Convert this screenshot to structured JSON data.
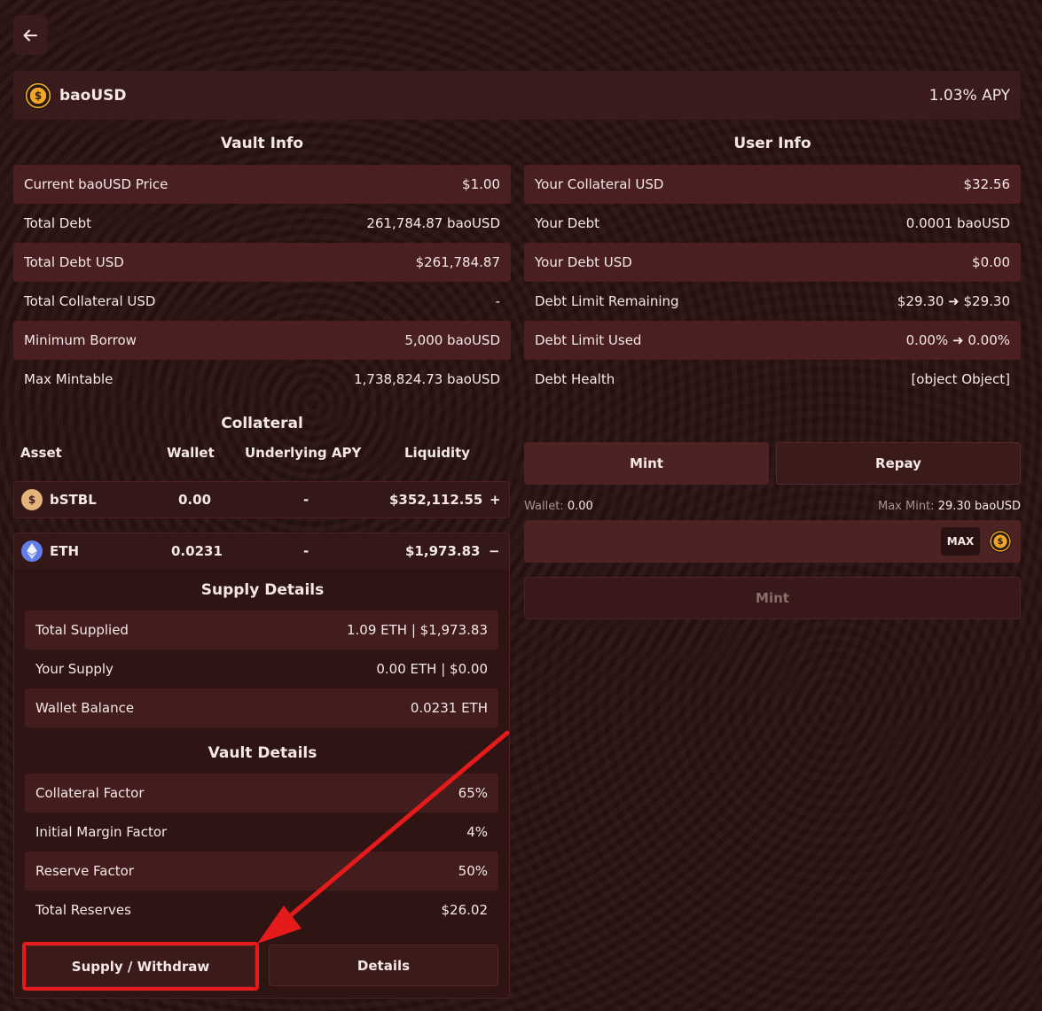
{
  "header": {
    "token_name": "baoUSD",
    "apy": "1.03% APY",
    "token_icon": "baousd-coin-icon"
  },
  "vault_info": {
    "title": "Vault Info",
    "rows": [
      {
        "label": "Current baoUSD Price",
        "value": "$1.00"
      },
      {
        "label": "Total Debt",
        "value": "261,784.87 baoUSD"
      },
      {
        "label": "Total Debt USD",
        "value": "$261,784.87"
      },
      {
        "label": "Total Collateral USD",
        "value": "-"
      },
      {
        "label": "Minimum Borrow",
        "value": "5,000 baoUSD"
      },
      {
        "label": "Max Mintable",
        "value": "1,738,824.73 baoUSD"
      }
    ]
  },
  "user_info": {
    "title": "User Info",
    "rows": [
      {
        "label": "Your Collateral USD",
        "value": "$32.56"
      },
      {
        "label": "Your Debt",
        "value": "0.0001 baoUSD"
      },
      {
        "label": "Your Debt USD",
        "value": "$0.00"
      },
      {
        "label": "Debt Limit Remaining",
        "value": "$29.30 ➜ $29.30"
      },
      {
        "label": "Debt Limit Used",
        "value": "0.00% ➜ 0.00%"
      },
      {
        "label": "Debt Health",
        "value": "[object Object]"
      }
    ]
  },
  "collateral": {
    "title": "Collateral",
    "columns": [
      "Asset",
      "Wallet",
      "Underlying APY",
      "Liquidity"
    ],
    "assets": [
      {
        "name": "bSTBL",
        "wallet": "0.00",
        "apy": "-",
        "liquidity": "$352,112.55",
        "toggle": "+"
      },
      {
        "name": "ETH",
        "wallet": "0.0231",
        "apy": "-",
        "liquidity": "$1,973.83",
        "toggle": "−"
      }
    ]
  },
  "supply_details": {
    "title": "Supply Details",
    "rows": [
      {
        "label": "Total Supplied",
        "value": "1.09 ETH | $1,973.83"
      },
      {
        "label": "Your Supply",
        "value": "0.00 ETH | $0.00"
      },
      {
        "label": "Wallet Balance",
        "value": "0.0231 ETH"
      }
    ]
  },
  "vault_details": {
    "title": "Vault Details",
    "rows": [
      {
        "label": "Collateral Factor",
        "value": "65%"
      },
      {
        "label": "Initial Margin Factor",
        "value": "4%"
      },
      {
        "label": "Reserve Factor",
        "value": "50%"
      },
      {
        "label": "Total Reserves",
        "value": "$26.02"
      }
    ]
  },
  "actions": {
    "supply_withdraw": "Supply / Withdraw",
    "details": "Details"
  },
  "mint_panel": {
    "tab_mint": "Mint",
    "tab_repay": "Repay",
    "wallet_label": "Wallet:",
    "wallet_value": "0.00",
    "max_mint_label": "Max Mint:",
    "max_mint_value": "29.30 baoUSD",
    "max_button": "MAX",
    "submit_label": "Mint"
  },
  "colors": {
    "background": "#2c1313",
    "panel": "#3a1b1b",
    "row_highlight": "#4a1f21",
    "button": "#4d2222",
    "annotation_red": "#e51a1a"
  }
}
